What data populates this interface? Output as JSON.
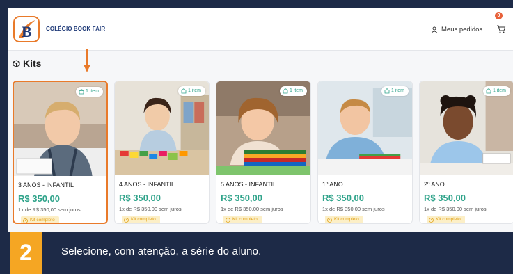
{
  "header": {
    "brand": "COLÉGIO BOOK FAIR",
    "orders_label": "Meus pedidos",
    "cart_count": "0",
    "icons": [
      "logo-b-icon",
      "user-icon",
      "cart-icon"
    ]
  },
  "section": {
    "title": "Kits",
    "icon": "box-icon"
  },
  "cards": [
    {
      "badge": "1 item",
      "grade": "3 ANOS - INFANTIL",
      "price": "R$ 350,00",
      "installment": "1x de R$ 350,00 sem juros",
      "kit": "Kit completo",
      "selected": true
    },
    {
      "badge": "1 item",
      "grade": "4 ANOS - INFANTIL",
      "price": "R$ 350,00",
      "installment": "1x de R$ 350,00 sem juros",
      "kit": "Kit completo",
      "selected": false
    },
    {
      "badge": "1 item",
      "grade": "5 ANOS - INFANTIL",
      "price": "R$ 350,00",
      "installment": "1x de R$ 350,00 sem juros",
      "kit": "Kit completo",
      "selected": false
    },
    {
      "badge": "1 item",
      "grade": "1º ANO",
      "price": "R$ 350,00",
      "installment": "1x de R$ 350,00 sem juros",
      "kit": "Kit completo",
      "selected": false
    },
    {
      "badge": "1 item",
      "grade": "2º ANO",
      "price": "R$ 350,00",
      "installment": "1x de R$ 350,00 sem juros",
      "kit": "Kit completo",
      "selected": false
    }
  ],
  "step": {
    "number": "2",
    "text": "Selecione, com atenção, a série do aluno."
  },
  "colors": {
    "accent_orange": "#e97a2a",
    "price_green": "#2fa38a",
    "banner_navy": "#1d2a47",
    "step_yellow": "#f5a623"
  }
}
